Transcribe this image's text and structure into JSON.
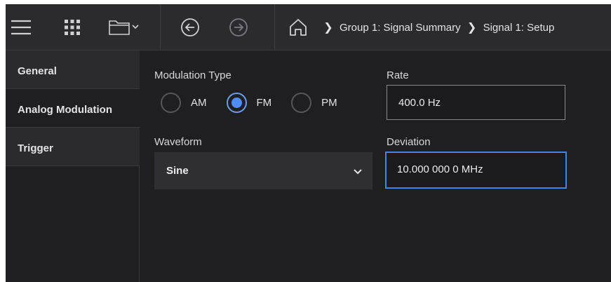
{
  "toolbar": {
    "icons": [
      "menu-icon",
      "apps-grid-icon",
      "folder-icon",
      "back-icon",
      "forward-icon",
      "home-icon"
    ],
    "breadcrumbs": [
      "Group 1: Signal Summary",
      "Signal 1: Setup"
    ]
  },
  "nav": {
    "items": [
      {
        "label": "General",
        "active": false
      },
      {
        "label": "Analog Modulation",
        "active": true
      },
      {
        "label": "Trigger",
        "active": false
      }
    ]
  },
  "modulation": {
    "label": "Modulation Type",
    "options": [
      "AM",
      "FM",
      "PM"
    ],
    "selected": "FM"
  },
  "rate": {
    "label": "Rate",
    "value": "400.0 Hz"
  },
  "waveform": {
    "label": "Waveform",
    "value": "Sine"
  },
  "deviation": {
    "label": "Deviation",
    "value": "10.000 000 0 MHz"
  },
  "colors": {
    "accent": "#4f8cf7",
    "focus": "#3c86f2",
    "background": "#1f1f22",
    "toolbar": "#2b2b2f"
  }
}
